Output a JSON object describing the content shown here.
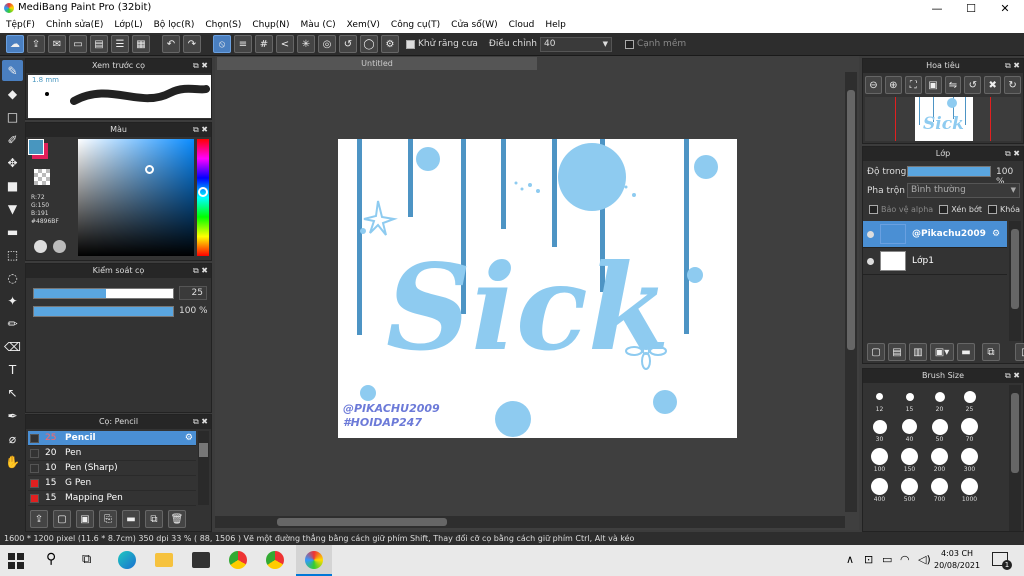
{
  "window": {
    "title": "MediBang Paint Pro (32bit)",
    "min": "—",
    "max": "☐",
    "close": "✕"
  },
  "menu": [
    "Tệp(F)",
    "Chỉnh sửa(E)",
    "Lớp(L)",
    "Bộ lọc(R)",
    "Chọn(S)",
    "Chụp(N)",
    "Màu (C)",
    "Xem(V)",
    "Công cụ(T)",
    "Cửa sổ(W)",
    "Cloud",
    "Help"
  ],
  "toolbar": {
    "antialias_label": "Khử răng cưa",
    "correction_label": "Điều chỉnh",
    "correction_value": "40",
    "edge_label": "Cạnh mềm"
  },
  "preview": {
    "title": "Xem trước cọ",
    "size_label": "1.8 mm"
  },
  "color": {
    "title": "Màu",
    "r": "R:72",
    "g": "G:150",
    "b": "B:191",
    "hex": "#4896BF",
    "fg": "#4896bf",
    "bg": "#e0205a"
  },
  "brush_control": {
    "title": "Kiểm soát cọ",
    "size_value": "25",
    "opacity_value": "100 %",
    "size_fraction": 0.52,
    "opacity_fraction": 1.0
  },
  "brush_list": {
    "title": "Cọ: Pencil",
    "items": [
      {
        "size": "25",
        "name": "Pencil",
        "selected": true,
        "red": false
      },
      {
        "size": "20",
        "name": "Pen",
        "selected": false,
        "red": false
      },
      {
        "size": "10",
        "name": "Pen (Sharp)",
        "selected": false,
        "red": false
      },
      {
        "size": "15",
        "name": "G Pen",
        "selected": false,
        "red": true
      },
      {
        "size": "15",
        "name": "Mapping Pen",
        "selected": false,
        "red": true
      }
    ]
  },
  "canvas": {
    "tab_title": "Untitled",
    "art_text": "Sick",
    "signature_1": "@PIKACHU2009",
    "signature_2": "#HOIDAP247"
  },
  "navigator": {
    "title": "Hoa tiêu"
  },
  "layer_panel": {
    "title": "Lớp",
    "opacity_label": "Độ trong",
    "opacity_value": "100 %",
    "blend_label": "Pha trộn",
    "blend_value": "Bình thường",
    "protect_alpha": "Bảo vệ alpha",
    "clipping": "Xén bớt",
    "lock": "Khóa",
    "layers": [
      {
        "name": "@Pikachu2009",
        "selected": true
      },
      {
        "name": "Lớp1",
        "selected": false
      }
    ]
  },
  "brush_size": {
    "title": "Brush Size",
    "sizes": [
      "12",
      "15",
      "20",
      "25",
      "30",
      "40",
      "50",
      "70",
      "100",
      "150",
      "200",
      "300",
      "400",
      "500",
      "700",
      "1000"
    ]
  },
  "status": {
    "text": "1600 * 1200 pixel  (11.6 * 8.7cm)  350 dpi  33 %  ( 88, 1506 )  Vẽ một đường thẳng bằng cách giữ phím Shift, Thay đổi cỡ cọ bằng cách giữ phím Ctrl, Alt và kéo"
  },
  "taskbar": {
    "time": "4:03 CH",
    "date": "20/08/2021",
    "notif": "1"
  }
}
